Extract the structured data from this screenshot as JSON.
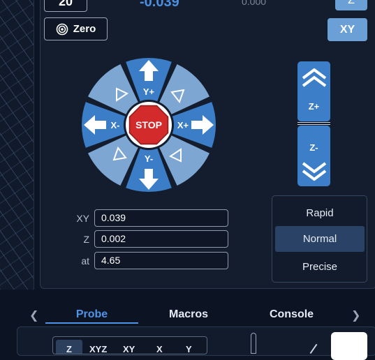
{
  "top_row": {
    "left_value": "20",
    "position_value": "-0.039",
    "secondary_value": "0.000",
    "axis_button": "Z"
  },
  "controls": {
    "zero_label": "Zero",
    "xy_label": "XY"
  },
  "jog": {
    "y_plus": "Y+",
    "y_minus": "Y-",
    "x_plus": "X+",
    "x_minus": "X-",
    "stop": "STOP",
    "z_plus": "Z+",
    "z_minus": "Z-",
    "colors": {
      "dark": "#3b7dc6",
      "light": "#7ea6d3",
      "stop": "#d32b2b"
    }
  },
  "step_fields": [
    {
      "label": "XY",
      "value": "0.039"
    },
    {
      "label": "Z",
      "value": "0.002"
    },
    {
      "label": "at",
      "value": "4.65"
    }
  ],
  "speed_options": [
    {
      "label": "Rapid",
      "active": false
    },
    {
      "label": "Normal",
      "active": true
    },
    {
      "label": "Precise",
      "active": false
    }
  ],
  "tabs": [
    {
      "label": "Probe",
      "active": true
    },
    {
      "label": "Macros",
      "active": false
    },
    {
      "label": "Console",
      "active": false
    }
  ],
  "probe_axes": [
    "Z",
    "XYZ",
    "XY",
    "X",
    "Y"
  ],
  "icons": {
    "left_arrow": "chevron-left-icon",
    "right_arrow": "chevron-right-icon",
    "target": "target-icon"
  }
}
